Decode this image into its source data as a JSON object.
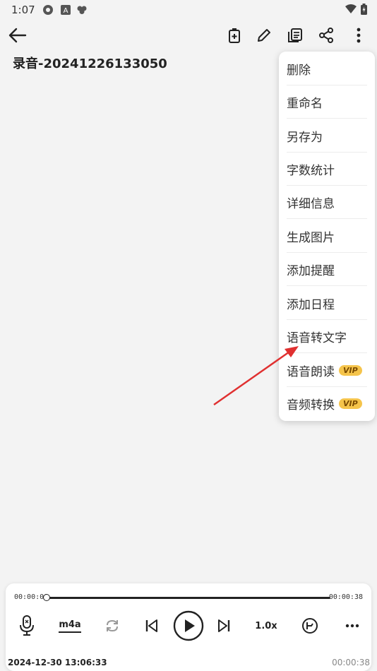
{
  "status": {
    "time": "1:07"
  },
  "title": "录音-20241226133050",
  "menu": {
    "items": [
      {
        "label": "删除"
      },
      {
        "label": "重命名"
      },
      {
        "label": "另存为"
      },
      {
        "label": "字数统计"
      },
      {
        "label": "详细信息"
      },
      {
        "label": "生成图片"
      },
      {
        "label": "添加提醒"
      },
      {
        "label": "添加日程"
      },
      {
        "label": "语音转文字"
      },
      {
        "label": "语音朗读",
        "badge": "VIP"
      },
      {
        "label": "音频转换",
        "badge": "VIP"
      }
    ]
  },
  "player": {
    "current_time": "00:00:00",
    "total_time": "00:00:38",
    "format": "m4a",
    "speed": "1.0x",
    "progress": 0
  },
  "footer": {
    "date": "2024-12-30 13:06:33",
    "end_time": "00:00:38"
  },
  "colors": {
    "vip_badge": "#f5c44b",
    "arrow": "#e03030"
  },
  "icons": [
    "back-icon",
    "add-file-icon",
    "edit-icon",
    "copy-icon",
    "share-icon",
    "more-vert-icon",
    "mic-icon",
    "repeat-icon",
    "skip-prev-icon",
    "play-icon",
    "skip-next-icon",
    "timer-icon",
    "more-horiz-icon"
  ]
}
